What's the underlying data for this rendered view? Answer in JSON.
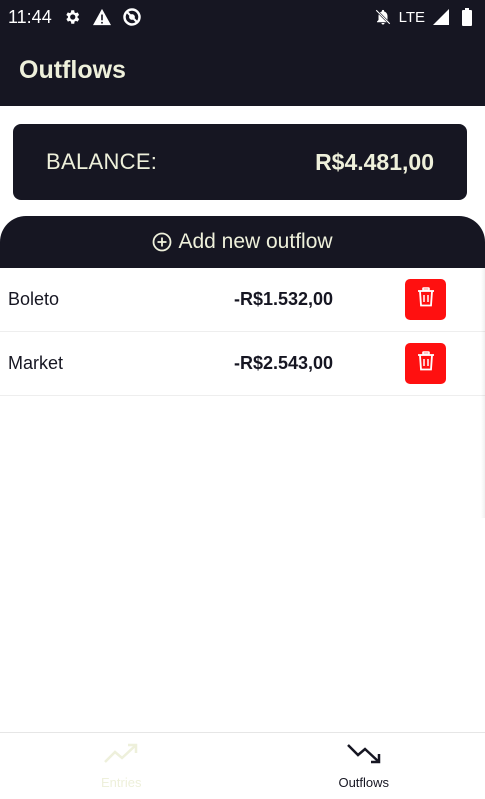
{
  "status_bar": {
    "time": "11:44",
    "network": "LTE",
    "left_icons": [
      "gear-icon",
      "warning-icon",
      "data-saver-icon"
    ],
    "right_icons": [
      "notifications-off-icon",
      "signal-icon",
      "battery-icon"
    ]
  },
  "app_bar": {
    "title": "Outflows"
  },
  "balance": {
    "label": "BALANCE:",
    "value": "R$4.481,00"
  },
  "add_outflow": {
    "label": "Add new outflow",
    "icon": "add-circle-icon"
  },
  "outflows": [
    {
      "name": "Boleto",
      "amount": "-R$1.532,00"
    },
    {
      "name": "Market",
      "amount": "-R$2.543,00"
    }
  ],
  "bottom_nav": {
    "tabs": [
      {
        "label": "Entries",
        "icon": "trending-up-icon",
        "active": false
      },
      {
        "label": "Outflows",
        "icon": "trending-down-icon",
        "active": true
      }
    ]
  },
  "colors": {
    "dark": "#161622",
    "cream": "#eef0db",
    "delete": "#ff1010"
  }
}
